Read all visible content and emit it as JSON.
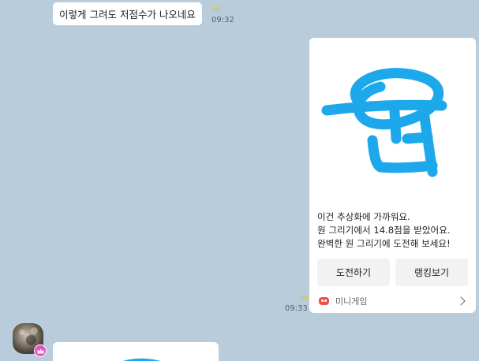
{
  "messages": {
    "first": {
      "text": "이렇게 그려도 저점수가 나오네요",
      "unread": "30",
      "time": "09:32"
    },
    "card": {
      "drawing_glyph": "원",
      "lines": [
        "이건 추상화에 가까워요.",
        "원 그리기에서 14.8점을 받았어요.",
        "완벽한 원 그리기에 도전해 보세요!"
      ],
      "buttons": {
        "challenge": "도전하기",
        "ranking": "랭킹보기"
      },
      "footer": {
        "label": "미니게임",
        "icon": "game-controller-icon"
      },
      "unread": "30",
      "time": "09:33"
    }
  },
  "colors": {
    "background": "#b9ccdc",
    "drawing_stroke": "#1ea8ec",
    "unread_count": "#d8c53a",
    "badge": "#ea4fc6"
  }
}
